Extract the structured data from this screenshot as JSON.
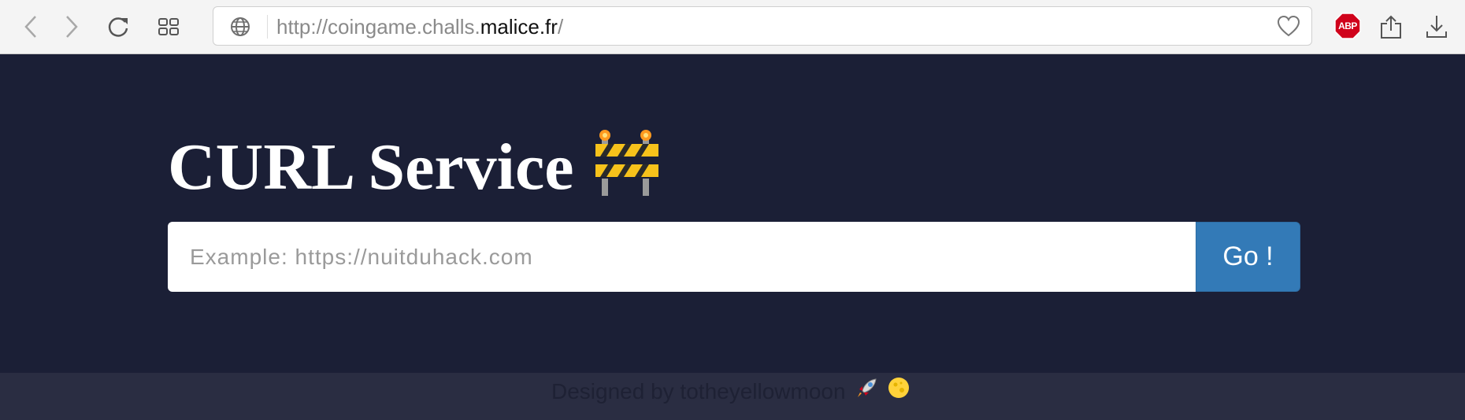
{
  "browser": {
    "url_prefix": "http://coingame.challs.",
    "url_domain": "malice.fr",
    "url_suffix": "/",
    "adblock_label": "ABP",
    "icons": [
      "back-icon",
      "forward-icon",
      "reload-icon",
      "tab-overview-icon",
      "globe-icon",
      "heart-icon",
      "adblock-icon",
      "share-icon",
      "download-icon"
    ]
  },
  "page": {
    "title": "CURL Service",
    "title_emoji": "construction-barrier-icon",
    "input_placeholder": "Example: https://nuitduhack.com",
    "input_value": "",
    "go_label": "Go !"
  },
  "footer": {
    "credit": "Designed by totheyellowmoon",
    "emojis": [
      "rocket-icon",
      "moon-icon"
    ]
  },
  "colors": {
    "page_bg": "#1b1f36",
    "footer_bg": "#2a2d42",
    "button": "#337ab7",
    "toolbar_bg": "#f4f4f4",
    "adblock_red": "#d0021b"
  }
}
